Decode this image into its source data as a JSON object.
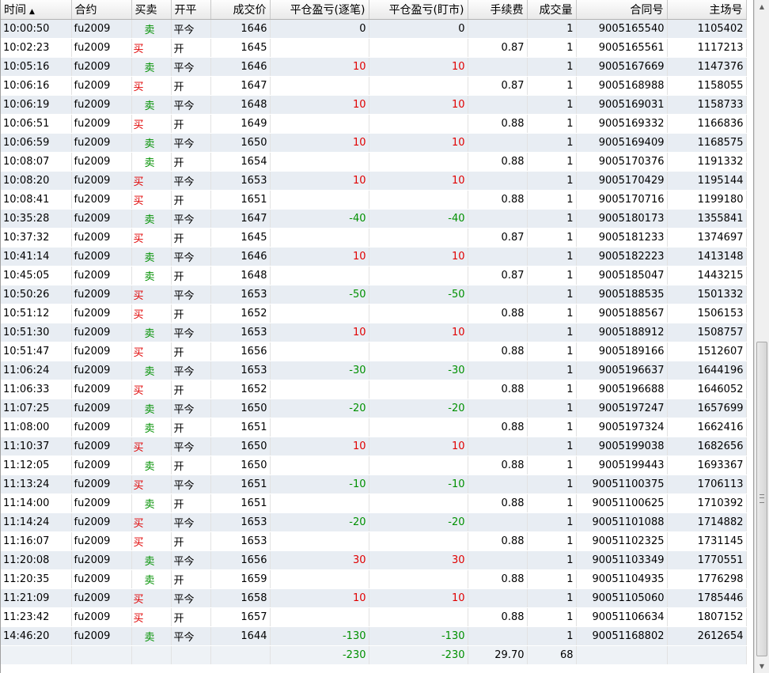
{
  "columns": [
    "时间",
    "合约",
    "买卖",
    "开平",
    "成交价",
    "平仓盈亏(逐笔)",
    "平仓盈亏(盯市)",
    "手续费",
    "成交量",
    "合同号",
    "主场号"
  ],
  "sort_arrow": "▲",
  "side_labels": {
    "buy": "买",
    "sell": "卖"
  },
  "colors": {
    "buy": "#e00000",
    "sell": "#009000",
    "row_alt": "#e8edf3"
  },
  "rows": [
    [
      "10:00:50",
      "fu2009",
      "sell",
      "平今",
      "1646",
      "0",
      "0",
      "",
      "1",
      "9005165540",
      "1105402"
    ],
    [
      "10:02:23",
      "fu2009",
      "buy",
      "开",
      "1645",
      "",
      "",
      "0.87",
      "1",
      "9005165561",
      "1117213"
    ],
    [
      "10:05:16",
      "fu2009",
      "sell",
      "平今",
      "1646",
      "10",
      "10",
      "",
      "1",
      "9005167669",
      "1147376"
    ],
    [
      "10:06:16",
      "fu2009",
      "buy",
      "开",
      "1647",
      "",
      "",
      "0.87",
      "1",
      "9005168988",
      "1158055"
    ],
    [
      "10:06:19",
      "fu2009",
      "sell",
      "平今",
      "1648",
      "10",
      "10",
      "",
      "1",
      "9005169031",
      "1158733"
    ],
    [
      "10:06:51",
      "fu2009",
      "buy",
      "开",
      "1649",
      "",
      "",
      "0.88",
      "1",
      "9005169332",
      "1166836"
    ],
    [
      "10:06:59",
      "fu2009",
      "sell",
      "平今",
      "1650",
      "10",
      "10",
      "",
      "1",
      "9005169409",
      "1168575"
    ],
    [
      "10:08:07",
      "fu2009",
      "sell",
      "开",
      "1654",
      "",
      "",
      "0.88",
      "1",
      "9005170376",
      "1191332"
    ],
    [
      "10:08:20",
      "fu2009",
      "buy",
      "平今",
      "1653",
      "10",
      "10",
      "",
      "1",
      "9005170429",
      "1195144"
    ],
    [
      "10:08:41",
      "fu2009",
      "buy",
      "开",
      "1651",
      "",
      "",
      "0.88",
      "1",
      "9005170716",
      "1199180"
    ],
    [
      "10:35:28",
      "fu2009",
      "sell",
      "平今",
      "1647",
      "-40",
      "-40",
      "",
      "1",
      "9005180173",
      "1355841"
    ],
    [
      "10:37:32",
      "fu2009",
      "buy",
      "开",
      "1645",
      "",
      "",
      "0.87",
      "1",
      "9005181233",
      "1374697"
    ],
    [
      "10:41:14",
      "fu2009",
      "sell",
      "平今",
      "1646",
      "10",
      "10",
      "",
      "1",
      "9005182223",
      "1413148"
    ],
    [
      "10:45:05",
      "fu2009",
      "sell",
      "开",
      "1648",
      "",
      "",
      "0.87",
      "1",
      "9005185047",
      "1443215"
    ],
    [
      "10:50:26",
      "fu2009",
      "buy",
      "平今",
      "1653",
      "-50",
      "-50",
      "",
      "1",
      "9005188535",
      "1501332"
    ],
    [
      "10:51:12",
      "fu2009",
      "buy",
      "开",
      "1652",
      "",
      "",
      "0.88",
      "1",
      "9005188567",
      "1506153"
    ],
    [
      "10:51:30",
      "fu2009",
      "sell",
      "平今",
      "1653",
      "10",
      "10",
      "",
      "1",
      "9005188912",
      "1508757"
    ],
    [
      "10:51:47",
      "fu2009",
      "buy",
      "开",
      "1656",
      "",
      "",
      "0.88",
      "1",
      "9005189166",
      "1512607"
    ],
    [
      "11:06:24",
      "fu2009",
      "sell",
      "平今",
      "1653",
      "-30",
      "-30",
      "",
      "1",
      "9005196637",
      "1644196"
    ],
    [
      "11:06:33",
      "fu2009",
      "buy",
      "开",
      "1652",
      "",
      "",
      "0.88",
      "1",
      "9005196688",
      "1646052"
    ],
    [
      "11:07:25",
      "fu2009",
      "sell",
      "平今",
      "1650",
      "-20",
      "-20",
      "",
      "1",
      "9005197247",
      "1657699"
    ],
    [
      "11:08:00",
      "fu2009",
      "sell",
      "开",
      "1651",
      "",
      "",
      "0.88",
      "1",
      "9005197324",
      "1662416"
    ],
    [
      "11:10:37",
      "fu2009",
      "buy",
      "平今",
      "1650",
      "10",
      "10",
      "",
      "1",
      "9005199038",
      "1682656"
    ],
    [
      "11:12:05",
      "fu2009",
      "sell",
      "开",
      "1650",
      "",
      "",
      "0.88",
      "1",
      "9005199443",
      "1693367"
    ],
    [
      "11:13:24",
      "fu2009",
      "buy",
      "平今",
      "1651",
      "-10",
      "-10",
      "",
      "1",
      "90051100375",
      "1706113"
    ],
    [
      "11:14:00",
      "fu2009",
      "sell",
      "开",
      "1651",
      "",
      "",
      "0.88",
      "1",
      "90051100625",
      "1710392"
    ],
    [
      "11:14:24",
      "fu2009",
      "buy",
      "平今",
      "1653",
      "-20",
      "-20",
      "",
      "1",
      "90051101088",
      "1714882"
    ],
    [
      "11:16:07",
      "fu2009",
      "buy",
      "开",
      "1653",
      "",
      "",
      "0.88",
      "1",
      "90051102325",
      "1731145"
    ],
    [
      "11:20:08",
      "fu2009",
      "sell",
      "平今",
      "1656",
      "30",
      "30",
      "",
      "1",
      "90051103349",
      "1770551"
    ],
    [
      "11:20:35",
      "fu2009",
      "sell",
      "开",
      "1659",
      "",
      "",
      "0.88",
      "1",
      "90051104935",
      "1776298"
    ],
    [
      "11:21:09",
      "fu2009",
      "buy",
      "平今",
      "1658",
      "10",
      "10",
      "",
      "1",
      "90051105060",
      "1785446"
    ],
    [
      "11:23:42",
      "fu2009",
      "buy",
      "开",
      "1657",
      "",
      "",
      "0.88",
      "1",
      "90051106634",
      "1807152"
    ],
    [
      "14:46:20",
      "fu2009",
      "sell",
      "平今",
      "1644",
      "-130",
      "-130",
      "",
      "1",
      "90051168802",
      "2612654"
    ]
  ],
  "totals": [
    "",
    "",
    "",
    "",
    "",
    "-230",
    "-230",
    "29.70",
    "68",
    "",
    ""
  ]
}
